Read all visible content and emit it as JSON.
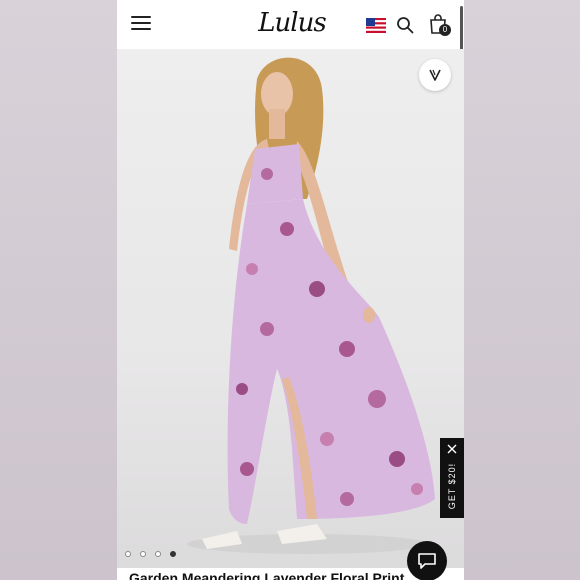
{
  "header": {
    "logo_text": "Lulus",
    "bag_count": "0",
    "icons": {
      "menu": "hamburger-icon",
      "flag": "us-flag-icon",
      "search": "search-icon",
      "bag": "shopping-bag-icon"
    }
  },
  "product": {
    "title": "Garden Meandering Lavender Floral Print",
    "image_count": 4,
    "active_image": 4,
    "dress_color": "#d9b8e0"
  },
  "promo": {
    "label": "GET $20!"
  },
  "colors": {
    "black": "#111111",
    "lavender": "#d9b8e0"
  }
}
